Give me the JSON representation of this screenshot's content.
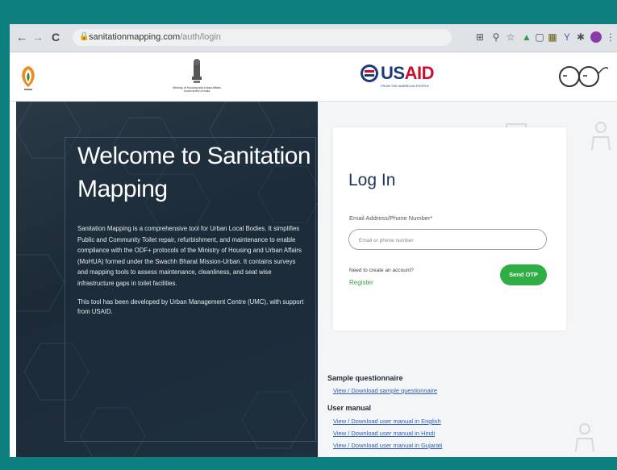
{
  "browser": {
    "nav": {
      "back": "←",
      "forward": "→",
      "reload": "C"
    },
    "url_host": "sanitationmapping.com",
    "url_path": "/auth/login",
    "toolbar_icons": [
      "qr-icon",
      "zoom-icon",
      "star-icon",
      "extension-icon",
      "extension-icon",
      "extension-icon",
      "extension-icon",
      "extension-icon",
      "profile-avatar",
      "menu-icon"
    ]
  },
  "header": {
    "ministry_caption": "Ministry of Housing and Urban Affairs Government of India",
    "usaid_text": "USAID",
    "usaid_us": "US",
    "usaid_aid": "AID",
    "usaid_tagline": "FROM THE AMERICAN PEOPLE"
  },
  "hero": {
    "title": "Welcome to Sanitation Mapping",
    "description": "Sanitation Mapping is a comprehensive tool for Urban Local Bodies. It simplifies Public and Community Toilet repair, refurbishment, and maintenance to enable compliance with the ODF+ protocols of the Ministry of Housing and Urban Affairs (MoHUA) formed under the Swachh Bharat Mission-Urban. It contains surveys and mapping tools to assess maintenance, cleanliness, and seat wise infrastructure gaps in toilet facilities.",
    "support": "This tool has been developed by Urban Management Centre (UMC), with support from USAID."
  },
  "login": {
    "title": "Log In",
    "field_label": "Email Address/Phone Number*",
    "field_placeholder": "Email or phone number",
    "need_account": "Need to create an account?",
    "register": "Register",
    "send_otp": "Send OTP"
  },
  "resources": {
    "sample_heading": "Sample questionnaire",
    "sample_links": [
      "View / Download sample questionnaire"
    ],
    "manual_heading": "User manual",
    "manual_links": [
      "View / Download user manual in English",
      "View / Download user manual in Hindi",
      "View / Download user manual in Gujarati"
    ]
  },
  "colors": {
    "frame": "#0e7f7f",
    "hero_bg": "#1f2f3f",
    "accent_green": "#2eae43",
    "link_blue": "#2b5fb8",
    "title_navy": "#1d3557"
  }
}
